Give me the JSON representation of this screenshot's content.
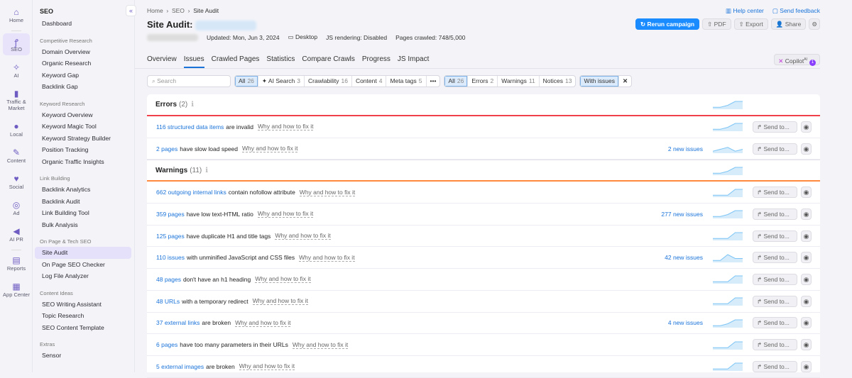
{
  "rail": [
    {
      "icon": "home-icon",
      "glyph": "⌂",
      "label": "Home"
    },
    {
      "icon": "seo-icon",
      "glyph": "ꝭ",
      "label": "SEO",
      "active": true
    },
    {
      "icon": "ai-icon",
      "glyph": "✧",
      "label": "AI"
    },
    {
      "icon": "traffic-icon",
      "glyph": "▮",
      "label": "Traffic & Market"
    },
    {
      "icon": "local-icon",
      "glyph": "●",
      "label": "Local"
    },
    {
      "icon": "content-icon",
      "glyph": "✎",
      "label": "Content"
    },
    {
      "icon": "social-icon",
      "glyph": "♥",
      "label": "Social"
    },
    {
      "icon": "ad-icon",
      "glyph": "◎",
      "label": "Ad"
    },
    {
      "icon": "ai-pr-icon",
      "glyph": "◀",
      "label": "AI PR"
    },
    {
      "icon": "reports-icon",
      "glyph": "▤",
      "label": "Reports"
    },
    {
      "icon": "app-center-icon",
      "glyph": "▦",
      "label": "App Center"
    }
  ],
  "sidebar": {
    "title": "SEO",
    "groups": [
      {
        "label": "",
        "items": [
          "Dashboard"
        ]
      },
      {
        "label": "Competitive Research",
        "items": [
          "Domain Overview",
          "Organic Research",
          "Keyword Gap",
          "Backlink Gap"
        ]
      },
      {
        "label": "Keyword Research",
        "items": [
          "Keyword Overview",
          "Keyword Magic Tool",
          "Keyword Strategy Builder",
          "Position Tracking",
          "Organic Traffic Insights"
        ]
      },
      {
        "label": "Link Building",
        "items": [
          "Backlink Analytics",
          "Backlink Audit",
          "Link Building Tool",
          "Bulk Analysis"
        ]
      },
      {
        "label": "On Page & Tech SEO",
        "items": [
          "Site Audit",
          "On Page SEO Checker",
          "Log File Analyzer"
        ]
      },
      {
        "label": "Content Ideas",
        "items": [
          "SEO Writing Assistant",
          "Topic Research",
          "SEO Content Template"
        ]
      },
      {
        "label": "Extras",
        "items": [
          "Sensor"
        ]
      }
    ],
    "active": "Site Audit"
  },
  "breadcrumb": [
    "Home",
    "SEO",
    "Site Audit"
  ],
  "header": {
    "title": "Site Audit:",
    "updated": "Updated: Mon, Jun 3, 2024",
    "device": "Desktop",
    "js": "JS rendering: Disabled",
    "pages": "Pages crawled: 748/5,000",
    "help": "Help center",
    "feedback": "Send feedback",
    "rerun": "Rerun campaign",
    "pdf": "PDF",
    "export": "Export",
    "share": "Share"
  },
  "tabs": [
    "Overview",
    "Issues",
    "Crawled Pages",
    "Statistics",
    "Compare Crawls",
    "Progress",
    "JS Impact"
  ],
  "activeTab": "Issues",
  "copilot": {
    "label": "Copilot",
    "sup": "AI",
    "count": "1"
  },
  "search": {
    "placeholder": "Search"
  },
  "categoryFilters": [
    {
      "label": "All",
      "n": "26",
      "sel": true
    },
    {
      "label": "✦ AI Search",
      "n": "3"
    },
    {
      "label": "Crawlability",
      "n": "16"
    },
    {
      "label": "Content",
      "n": "4"
    },
    {
      "label": "Meta tags",
      "n": "5"
    },
    {
      "label": "•••",
      "n": ""
    }
  ],
  "typeFilters": [
    {
      "label": "All",
      "n": "26",
      "sel": true
    },
    {
      "label": "Errors",
      "n": "2"
    },
    {
      "label": "Warnings",
      "n": "11"
    },
    {
      "label": "Notices",
      "n": "13"
    }
  ],
  "withIssues": "With issues",
  "colors": {
    "error": "#f0414a",
    "warning": "#ff8a3d",
    "link": "#1a73d9"
  },
  "why": "Why and how to fix it",
  "send": "Send to...",
  "sections": [
    {
      "title": "Errors",
      "count": "(2)",
      "color": "#f0414a",
      "spark": [
        1,
        1,
        2,
        4,
        4
      ],
      "rows": [
        {
          "link": "116 structured data items",
          "text": "are invalid",
          "new": "",
          "spark": [
            1,
            1,
            2,
            4,
            4
          ]
        },
        {
          "link": "2 pages",
          "text": "have slow load speed",
          "new": "2 new issues",
          "spark": [
            1,
            2,
            3,
            1,
            2
          ]
        }
      ]
    },
    {
      "title": "Warnings",
      "count": "(11)",
      "color": "#ff8a3d",
      "spark": [
        1,
        1,
        2,
        4,
        4
      ],
      "rows": [
        {
          "link": "662 outgoing internal links",
          "text": "contain nofollow attribute",
          "new": "",
          "spark": [
            1,
            1,
            1,
            4,
            4
          ]
        },
        {
          "link": "359 pages",
          "text": "have low text-HTML ratio",
          "new": "277 new issues",
          "spark": [
            1,
            1,
            2,
            4,
            4
          ]
        },
        {
          "link": "125 pages",
          "text": "have duplicate H1 and title tags",
          "new": "",
          "spark": [
            1,
            1,
            1,
            4,
            4
          ]
        },
        {
          "link": "110 issues",
          "text": "with unminified JavaScript and CSS files",
          "new": "42 new issues",
          "spark": [
            1,
            1,
            4,
            2,
            2
          ]
        },
        {
          "link": "48 pages",
          "text": "don't have an h1 heading",
          "new": "",
          "spark": [
            1,
            1,
            1,
            4,
            4
          ]
        },
        {
          "link": "48 URLs",
          "text": "with a temporary redirect",
          "new": "",
          "spark": [
            1,
            1,
            1,
            4,
            4
          ]
        },
        {
          "link": "37 external links",
          "text": "are broken",
          "new": "4 new issues",
          "spark": [
            1,
            1,
            2,
            4,
            4
          ]
        },
        {
          "link": "6 pages",
          "text": "have too many parameters in their URLs",
          "new": "",
          "spark": [
            1,
            1,
            1,
            4,
            4
          ]
        },
        {
          "link": "5 external images",
          "text": "are broken",
          "new": "",
          "spark": [
            1,
            1,
            1,
            4,
            4
          ]
        }
      ]
    }
  ]
}
